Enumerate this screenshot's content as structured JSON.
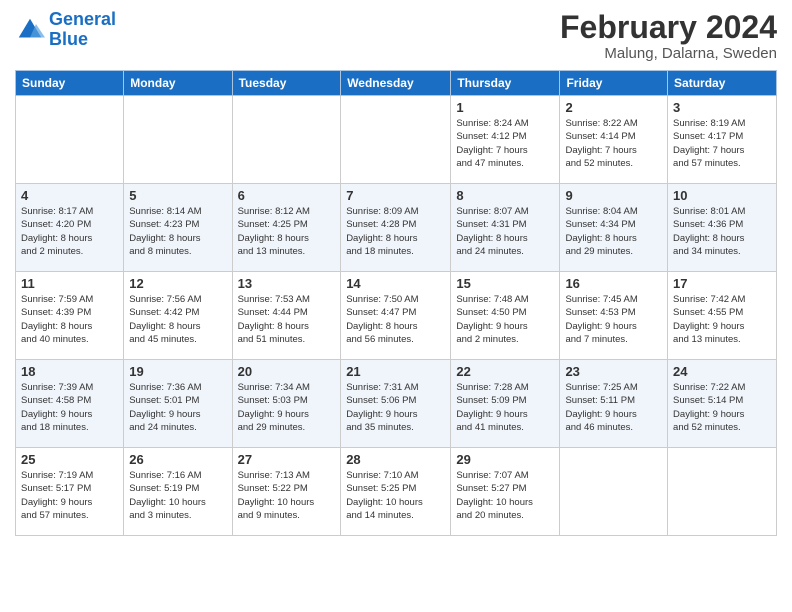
{
  "header": {
    "logo_line1": "General",
    "logo_line2": "Blue",
    "main_title": "February 2024",
    "subtitle": "Malung, Dalarna, Sweden"
  },
  "weekdays": [
    "Sunday",
    "Monday",
    "Tuesday",
    "Wednesday",
    "Thursday",
    "Friday",
    "Saturday"
  ],
  "weeks": [
    [
      {
        "day": "",
        "detail": ""
      },
      {
        "day": "",
        "detail": ""
      },
      {
        "day": "",
        "detail": ""
      },
      {
        "day": "",
        "detail": ""
      },
      {
        "day": "1",
        "detail": "Sunrise: 8:24 AM\nSunset: 4:12 PM\nDaylight: 7 hours\nand 47 minutes."
      },
      {
        "day": "2",
        "detail": "Sunrise: 8:22 AM\nSunset: 4:14 PM\nDaylight: 7 hours\nand 52 minutes."
      },
      {
        "day": "3",
        "detail": "Sunrise: 8:19 AM\nSunset: 4:17 PM\nDaylight: 7 hours\nand 57 minutes."
      }
    ],
    [
      {
        "day": "4",
        "detail": "Sunrise: 8:17 AM\nSunset: 4:20 PM\nDaylight: 8 hours\nand 2 minutes."
      },
      {
        "day": "5",
        "detail": "Sunrise: 8:14 AM\nSunset: 4:23 PM\nDaylight: 8 hours\nand 8 minutes."
      },
      {
        "day": "6",
        "detail": "Sunrise: 8:12 AM\nSunset: 4:25 PM\nDaylight: 8 hours\nand 13 minutes."
      },
      {
        "day": "7",
        "detail": "Sunrise: 8:09 AM\nSunset: 4:28 PM\nDaylight: 8 hours\nand 18 minutes."
      },
      {
        "day": "8",
        "detail": "Sunrise: 8:07 AM\nSunset: 4:31 PM\nDaylight: 8 hours\nand 24 minutes."
      },
      {
        "day": "9",
        "detail": "Sunrise: 8:04 AM\nSunset: 4:34 PM\nDaylight: 8 hours\nand 29 minutes."
      },
      {
        "day": "10",
        "detail": "Sunrise: 8:01 AM\nSunset: 4:36 PM\nDaylight: 8 hours\nand 34 minutes."
      }
    ],
    [
      {
        "day": "11",
        "detail": "Sunrise: 7:59 AM\nSunset: 4:39 PM\nDaylight: 8 hours\nand 40 minutes."
      },
      {
        "day": "12",
        "detail": "Sunrise: 7:56 AM\nSunset: 4:42 PM\nDaylight: 8 hours\nand 45 minutes."
      },
      {
        "day": "13",
        "detail": "Sunrise: 7:53 AM\nSunset: 4:44 PM\nDaylight: 8 hours\nand 51 minutes."
      },
      {
        "day": "14",
        "detail": "Sunrise: 7:50 AM\nSunset: 4:47 PM\nDaylight: 8 hours\nand 56 minutes."
      },
      {
        "day": "15",
        "detail": "Sunrise: 7:48 AM\nSunset: 4:50 PM\nDaylight: 9 hours\nand 2 minutes."
      },
      {
        "day": "16",
        "detail": "Sunrise: 7:45 AM\nSunset: 4:53 PM\nDaylight: 9 hours\nand 7 minutes."
      },
      {
        "day": "17",
        "detail": "Sunrise: 7:42 AM\nSunset: 4:55 PM\nDaylight: 9 hours\nand 13 minutes."
      }
    ],
    [
      {
        "day": "18",
        "detail": "Sunrise: 7:39 AM\nSunset: 4:58 PM\nDaylight: 9 hours\nand 18 minutes."
      },
      {
        "day": "19",
        "detail": "Sunrise: 7:36 AM\nSunset: 5:01 PM\nDaylight: 9 hours\nand 24 minutes."
      },
      {
        "day": "20",
        "detail": "Sunrise: 7:34 AM\nSunset: 5:03 PM\nDaylight: 9 hours\nand 29 minutes."
      },
      {
        "day": "21",
        "detail": "Sunrise: 7:31 AM\nSunset: 5:06 PM\nDaylight: 9 hours\nand 35 minutes."
      },
      {
        "day": "22",
        "detail": "Sunrise: 7:28 AM\nSunset: 5:09 PM\nDaylight: 9 hours\nand 41 minutes."
      },
      {
        "day": "23",
        "detail": "Sunrise: 7:25 AM\nSunset: 5:11 PM\nDaylight: 9 hours\nand 46 minutes."
      },
      {
        "day": "24",
        "detail": "Sunrise: 7:22 AM\nSunset: 5:14 PM\nDaylight: 9 hours\nand 52 minutes."
      }
    ],
    [
      {
        "day": "25",
        "detail": "Sunrise: 7:19 AM\nSunset: 5:17 PM\nDaylight: 9 hours\nand 57 minutes."
      },
      {
        "day": "26",
        "detail": "Sunrise: 7:16 AM\nSunset: 5:19 PM\nDaylight: 10 hours\nand 3 minutes."
      },
      {
        "day": "27",
        "detail": "Sunrise: 7:13 AM\nSunset: 5:22 PM\nDaylight: 10 hours\nand 9 minutes."
      },
      {
        "day": "28",
        "detail": "Sunrise: 7:10 AM\nSunset: 5:25 PM\nDaylight: 10 hours\nand 14 minutes."
      },
      {
        "day": "29",
        "detail": "Sunrise: 7:07 AM\nSunset: 5:27 PM\nDaylight: 10 hours\nand 20 minutes."
      },
      {
        "day": "",
        "detail": ""
      },
      {
        "day": "",
        "detail": ""
      }
    ]
  ]
}
